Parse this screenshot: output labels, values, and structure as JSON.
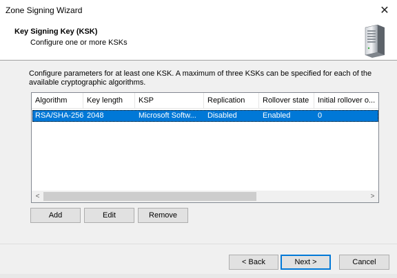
{
  "window": {
    "title": "Zone Signing Wizard",
    "close_glyph": "✕"
  },
  "header": {
    "title": "Key Signing Key (KSK)",
    "subtitle": "Configure one or more KSKs",
    "icon": "server-icon"
  },
  "description": "Configure parameters for at least one KSK. A maximum of three KSKs can be specified for each of the available cryptographic algorithms.",
  "table": {
    "columns": [
      "Algorithm",
      "Key length",
      "KSP",
      "Replication",
      "Rollover state",
      "Initial rollover o..."
    ],
    "rows": [
      {
        "algorithm": "RSA/SHA-256",
        "key_length": "2048",
        "ksp": "Microsoft Softw...",
        "replication": "Disabled",
        "rollover_state": "Enabled",
        "initial_rollover": "0",
        "selected": true
      }
    ],
    "scroll_left_glyph": "<",
    "scroll_right_glyph": ">"
  },
  "actions": {
    "add": "Add",
    "edit": "Edit",
    "remove": "Remove"
  },
  "nav": {
    "back": "< Back",
    "next": "Next >",
    "cancel": "Cancel"
  },
  "colors": {
    "selection": "#0078d7",
    "accent": "#0078d7"
  }
}
